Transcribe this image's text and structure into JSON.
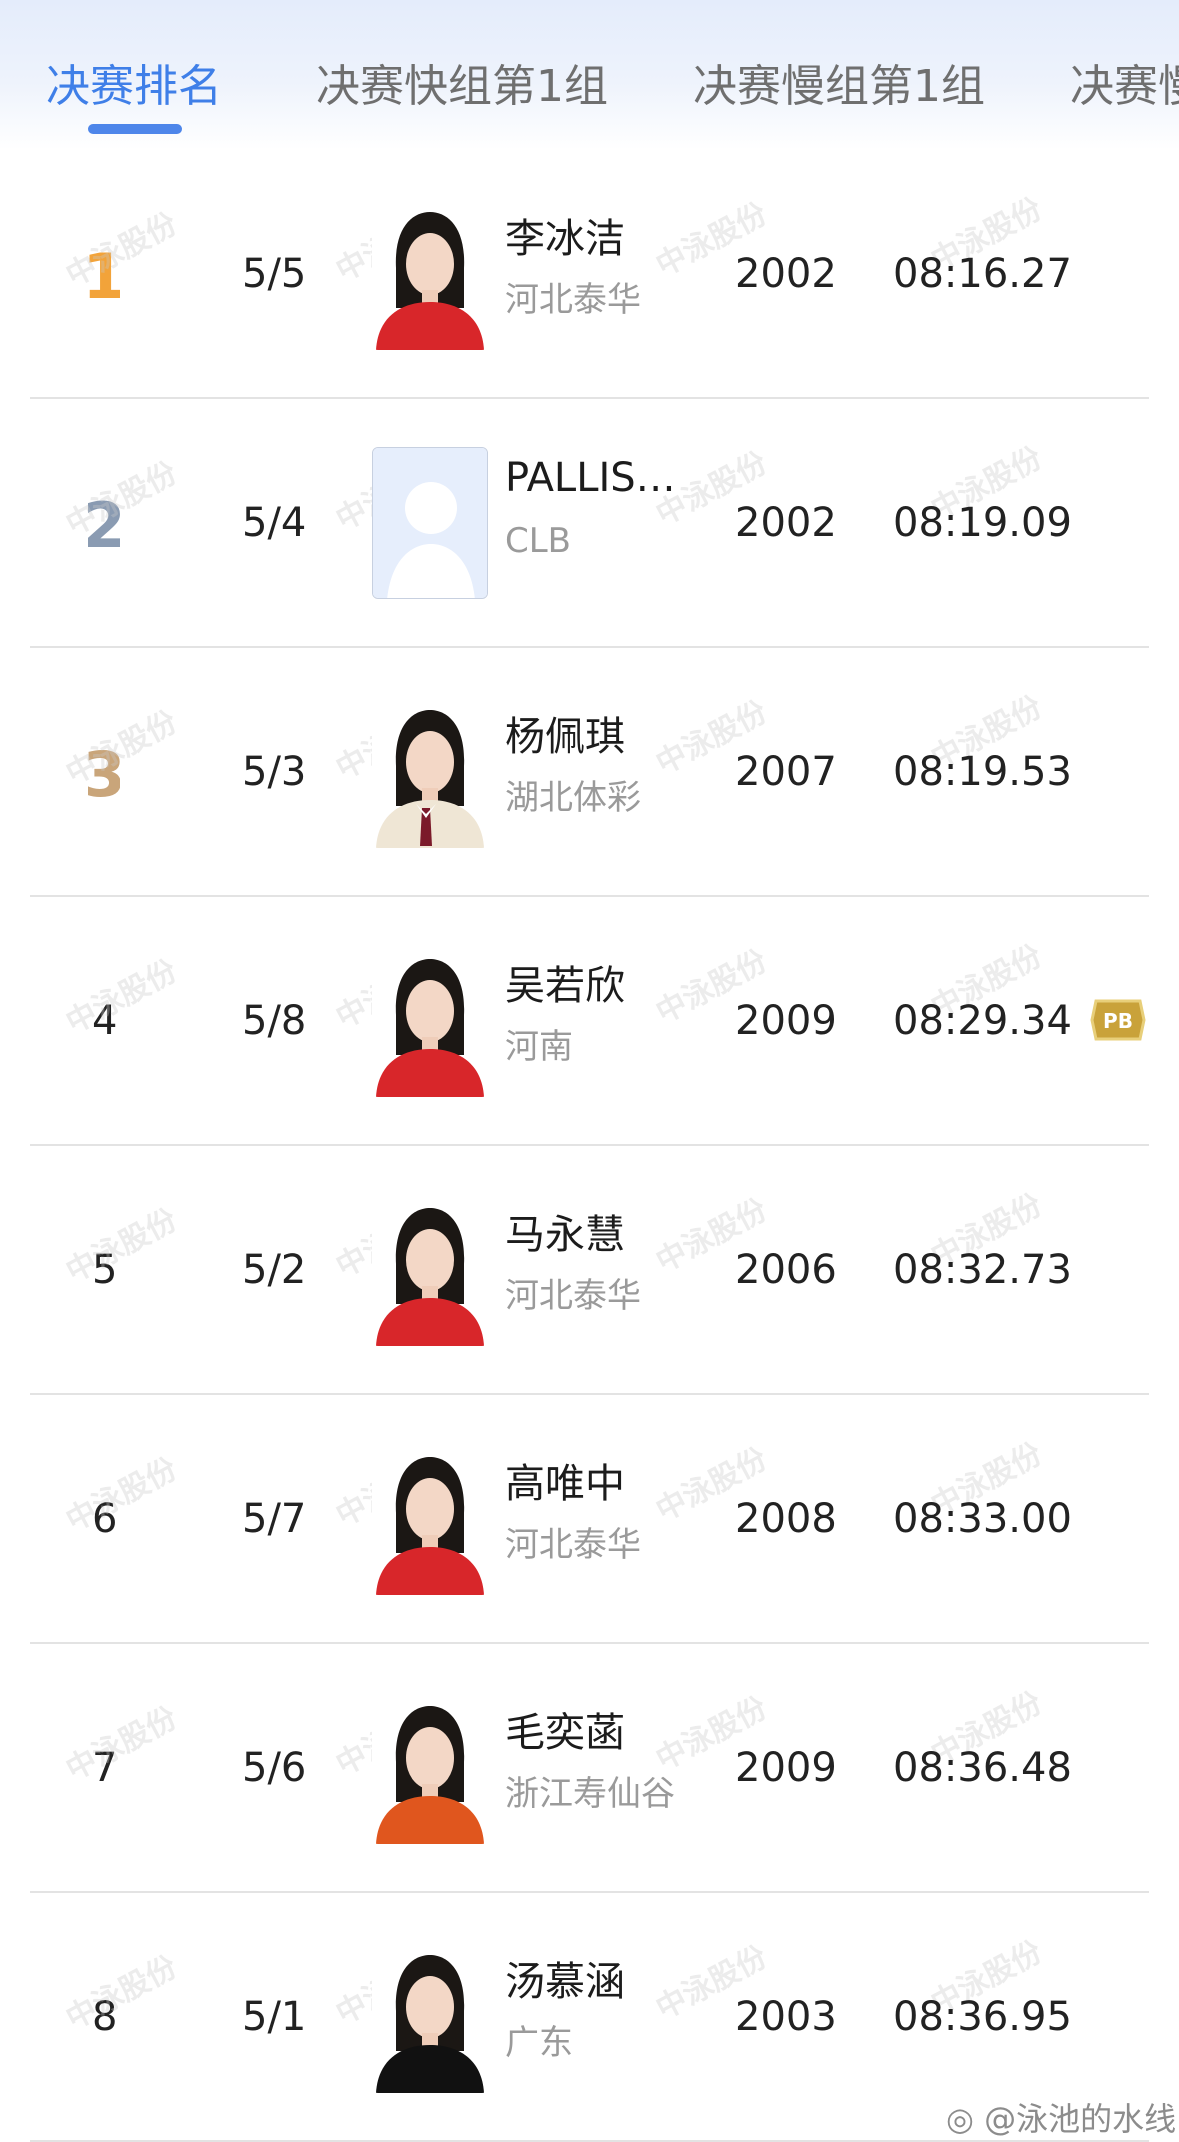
{
  "tabs": [
    {
      "label": "决赛排名",
      "active": true
    },
    {
      "label": "决赛快组第1组",
      "active": false
    },
    {
      "label": "决赛慢组第1组",
      "active": false
    },
    {
      "label": "决赛慢",
      "active": false
    }
  ],
  "watermark": "中泳股份",
  "results": [
    {
      "rank": "1",
      "medal": "gold",
      "lane": "5/5",
      "name": "李冰洁",
      "team": "河北泰华",
      "year": "2002",
      "time": "08:16.27",
      "pb": false,
      "photo": "red"
    },
    {
      "rank": "2",
      "medal": "silver",
      "lane": "5/4",
      "name": "PALLIS…",
      "team": "CLB",
      "year": "2002",
      "time": "08:19.09",
      "pb": false,
      "photo": "placeholder"
    },
    {
      "rank": "3",
      "medal": "bronze",
      "lane": "5/3",
      "name": "杨佩琪",
      "team": "湖北体彩",
      "year": "2007",
      "time": "08:19.53",
      "pb": false,
      "photo": "suit"
    },
    {
      "rank": "4",
      "medal": "",
      "lane": "5/8",
      "name": "吴若欣",
      "team": "河南",
      "year": "2009",
      "time": "08:29.34",
      "pb": true,
      "photo": "red"
    },
    {
      "rank": "5",
      "medal": "",
      "lane": "5/2",
      "name": "马永慧",
      "team": "河北泰华",
      "year": "2006",
      "time": "08:32.73",
      "pb": false,
      "photo": "red"
    },
    {
      "rank": "6",
      "medal": "",
      "lane": "5/7",
      "name": "高唯中",
      "team": "河北泰华",
      "year": "2008",
      "time": "08:33.00",
      "pb": false,
      "photo": "red"
    },
    {
      "rank": "7",
      "medal": "",
      "lane": "5/6",
      "name": "毛奕菡",
      "team": "浙江寿仙谷",
      "year": "2009",
      "time": "08:36.48",
      "pb": false,
      "photo": "orange"
    },
    {
      "rank": "8",
      "medal": "",
      "lane": "5/1",
      "name": "汤慕涵",
      "team": "广东",
      "year": "2003",
      "time": "08:36.95",
      "pb": false,
      "photo": "black"
    }
  ],
  "pb_label": "PB",
  "footer": {
    "weibo": "@泳池的水线"
  },
  "colors": {
    "accent": "#3f7fe8",
    "gold": "#f2a33a",
    "silver": "#8a9bb2",
    "bronze": "#c9a57a",
    "pb": "#c9a23a"
  }
}
